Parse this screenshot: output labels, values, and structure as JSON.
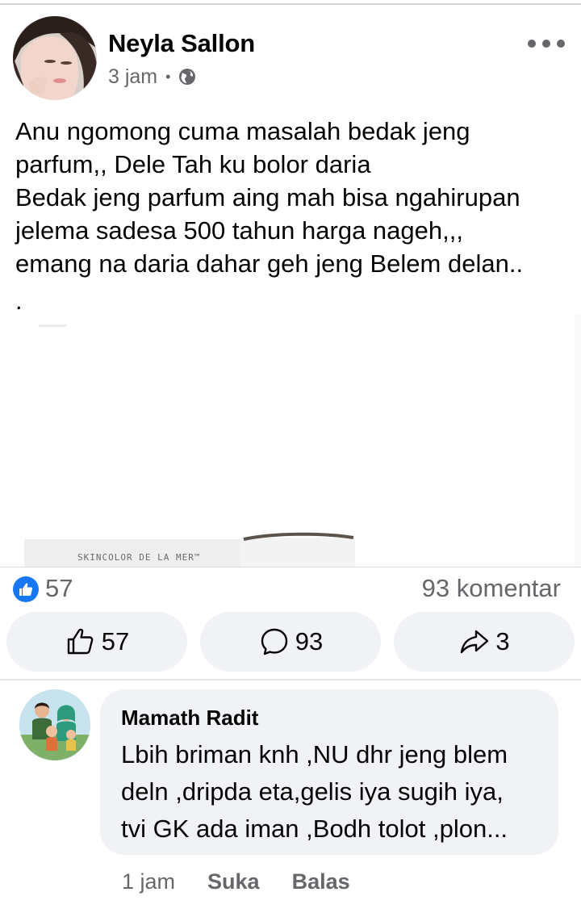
{
  "post": {
    "author": "Neyla Sallon",
    "time": "3 jam",
    "separator": "•",
    "privacy_icon": "globe-icon",
    "more_icon": "more-horizontal-icon",
    "text_lines": [
      "Anu ngomong cuma masalah bedak jeng",
      "parfum,, Dele Tah ku bolor daria",
      "Bedak jeng parfum aing mah bisa ngahirupan",
      "jelema sadesa 500 tahun harga nageh,,,",
      "emang na daria dahar geh jeng Belem delan..",
      "."
    ],
    "image_brand_text": "SKINCOLOR DE LA MER™"
  },
  "reactions": {
    "like_icon": "thumbs-up-badge-icon",
    "count": "57",
    "comments_label": "93 komentar"
  },
  "actions": {
    "like_count": "57",
    "comment_count": "93",
    "share_count": "3"
  },
  "comment": {
    "author": "Mamath Radit",
    "text_lines": [
      "Lbih briman knh ,NU dhr jeng blem",
      "deln ,dripda eta,gelis iya sugih iya,",
      "tvi GK ada iman ,Bodh tolot ,plon..."
    ],
    "time": "1 jam",
    "like_label": "Suka",
    "reply_label": "Balas"
  },
  "colors": {
    "accent": "#1877f2",
    "secondary_text": "#65676b",
    "pill_bg": "#f0f2f5"
  }
}
